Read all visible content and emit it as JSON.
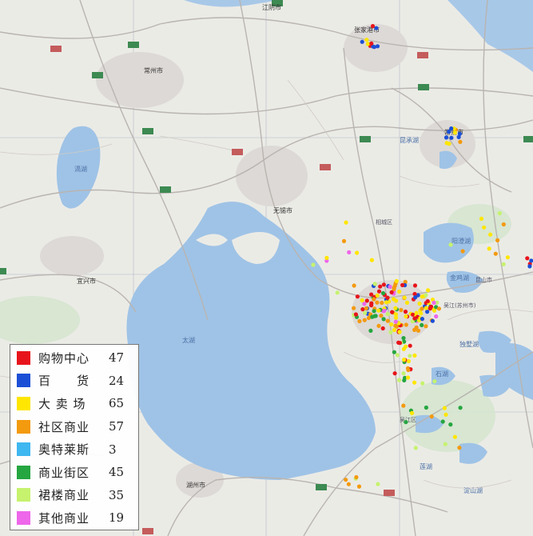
{
  "legend": {
    "items": [
      {
        "label": "购物中心",
        "count": "47",
        "color": "#e8141b"
      },
      {
        "label": "百　　货",
        "count": "24",
        "color": "#1b4fd6"
      },
      {
        "label": "大 卖 场",
        "count": "65",
        "color": "#ffe600"
      },
      {
        "label": "社区商业",
        "count": "57",
        "color": "#f39a0e"
      },
      {
        "label": "奥特莱斯",
        "count": "3",
        "color": "#3fb7f0"
      },
      {
        "label": "商业街区",
        "count": "45",
        "color": "#25a640"
      },
      {
        "label": "裙楼商业",
        "count": "35",
        "color": "#c6f26e"
      },
      {
        "label": "其他商业",
        "count": "19",
        "color": "#ee66ea"
      }
    ]
  },
  "places": {
    "zhangjiagang": "张家港市",
    "changzhou": "常州市",
    "jiangyin": "江阴市",
    "wuxi": "无锡市",
    "changshu": "常熟市",
    "yixing": "宜兴市",
    "huzhou": "湖州市",
    "gehu": "滆湖",
    "taihu": "太湖",
    "yangchenghu": "阳澄湖",
    "dushuhu": "独墅湖",
    "jinjihu": "金鸡湖",
    "shihu": "石湖",
    "lianhu": "莲湖",
    "kunshanhu": "昆承湖",
    "dianshanhu": "淀山湖",
    "wujiang": "吴江区",
    "xiangcheng": "相城区",
    "kunshan": "昆山市",
    "suzhou_label": "吴江(苏州市)"
  }
}
